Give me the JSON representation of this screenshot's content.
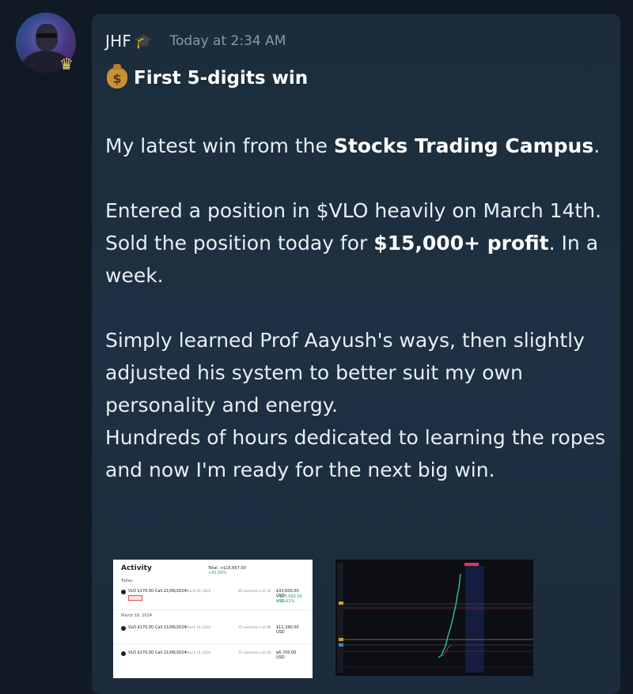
{
  "message": {
    "username": "JHF",
    "timestamp": "Today at 2:34 AM",
    "title": "First 5-digits win",
    "icons": {
      "role_badge": "graduation-cap-icon",
      "avatar_badge": "crown-icon",
      "title_emoji": "money-bag-icon"
    },
    "paragraphs": {
      "p1_start": "My latest win from the ",
      "p1_bold": "Stocks Trading Campus",
      "p1_end": ".",
      "p2_line1": "Entered a position in $VLO heavily on March 14th.",
      "p2_line2_start": "Sold the position today for ",
      "p2_line2_bold": "$15,000+ profit",
      "p2_line2_end": ". In a week.",
      "p3_line1": "Simply learned Prof Aayush's ways, then slightly adjusted his system to better suit my own personality and energy.",
      "p3_line2": "Hundreds of hours dedicated to learning the ropes and now I'm ready for the next big win."
    }
  },
  "attachments": {
    "activity": {
      "title": "Activity",
      "total_label": "Total: +$15,657.00",
      "total_pct": "+92.90%",
      "section_today": "Today",
      "section_march": "March 16, 2024",
      "rows": [
        {
          "contract": "VLO $170.00 Call 21/06/2024",
          "date": "March 20, 2024",
          "detail": "50 contracts x $7.33",
          "amount": "$33,600.00 USD",
          "gain": "+$15,660.00 USD",
          "gain_pct": "+92.61%"
        },
        {
          "contract": "VLO $170.00 Call 21/06/2024",
          "date": "March 14, 2024",
          "detail": "75 contracts x $3.80",
          "amount": "$11,340.00 USD"
        },
        {
          "contract": "VLO $170.00 Call 21/06/2024",
          "date": "March 14, 2024",
          "detail": "15 contracts x $4.20",
          "amount": "$6,700.00 USD"
        }
      ]
    },
    "chart_colors": {
      "background": "#0c0e14",
      "candle_up": "#2fc58b",
      "highlight": "#e0345a",
      "band": "#3a4fa0"
    }
  },
  "colors": {
    "background": "#0f1a24",
    "bubble": "#1c2c3a",
    "timestamp": "#8a99a6",
    "text": "#e8eef2"
  }
}
